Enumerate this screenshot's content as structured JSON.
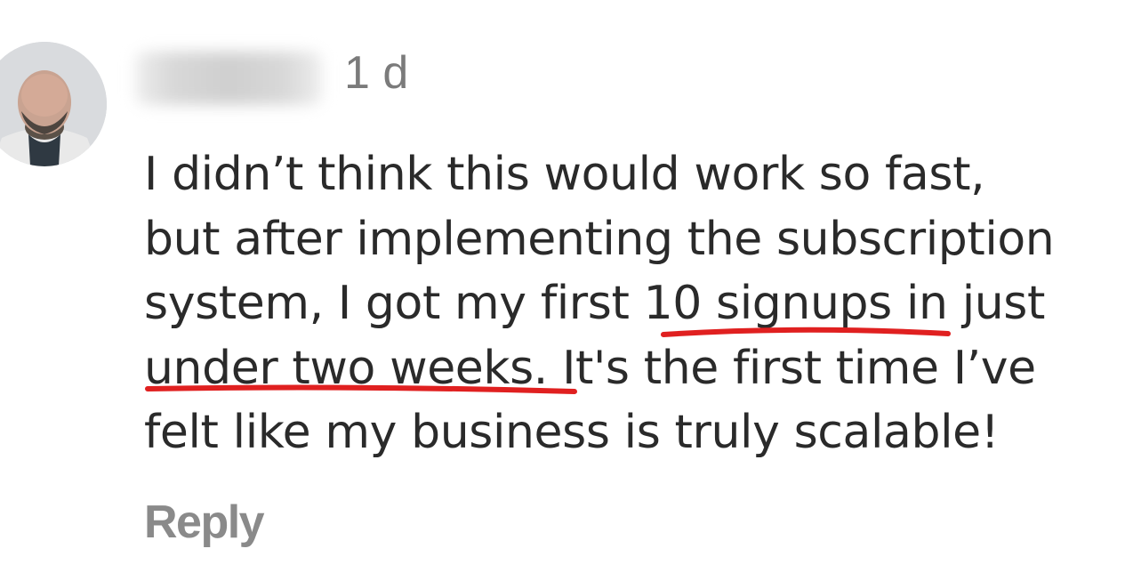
{
  "comment": {
    "timestamp": "1 d",
    "body_lines": [
      {
        "before": "I didn’t think this would work so fast,",
        "highlight": "",
        "after": ""
      },
      {
        "before": "but after implementing the subscription",
        "highlight": "",
        "after": ""
      },
      {
        "before": "system, I got my first ",
        "highlight": "10 signups",
        "after": " in just"
      },
      {
        "before": "",
        "highlight": "under two weeks.",
        "after": " It's the first time I’ve"
      },
      {
        "before": "felt like my business is truly scalable!",
        "highlight": "",
        "after": ""
      }
    ],
    "reply_label": "Reply"
  },
  "colors": {
    "text": "#2a2a2a",
    "timestamp": "#7b7b7b",
    "reply": "#8a8a8a",
    "underline": "#e02020"
  },
  "icons": {
    "avatar": "user-avatar-photo"
  }
}
